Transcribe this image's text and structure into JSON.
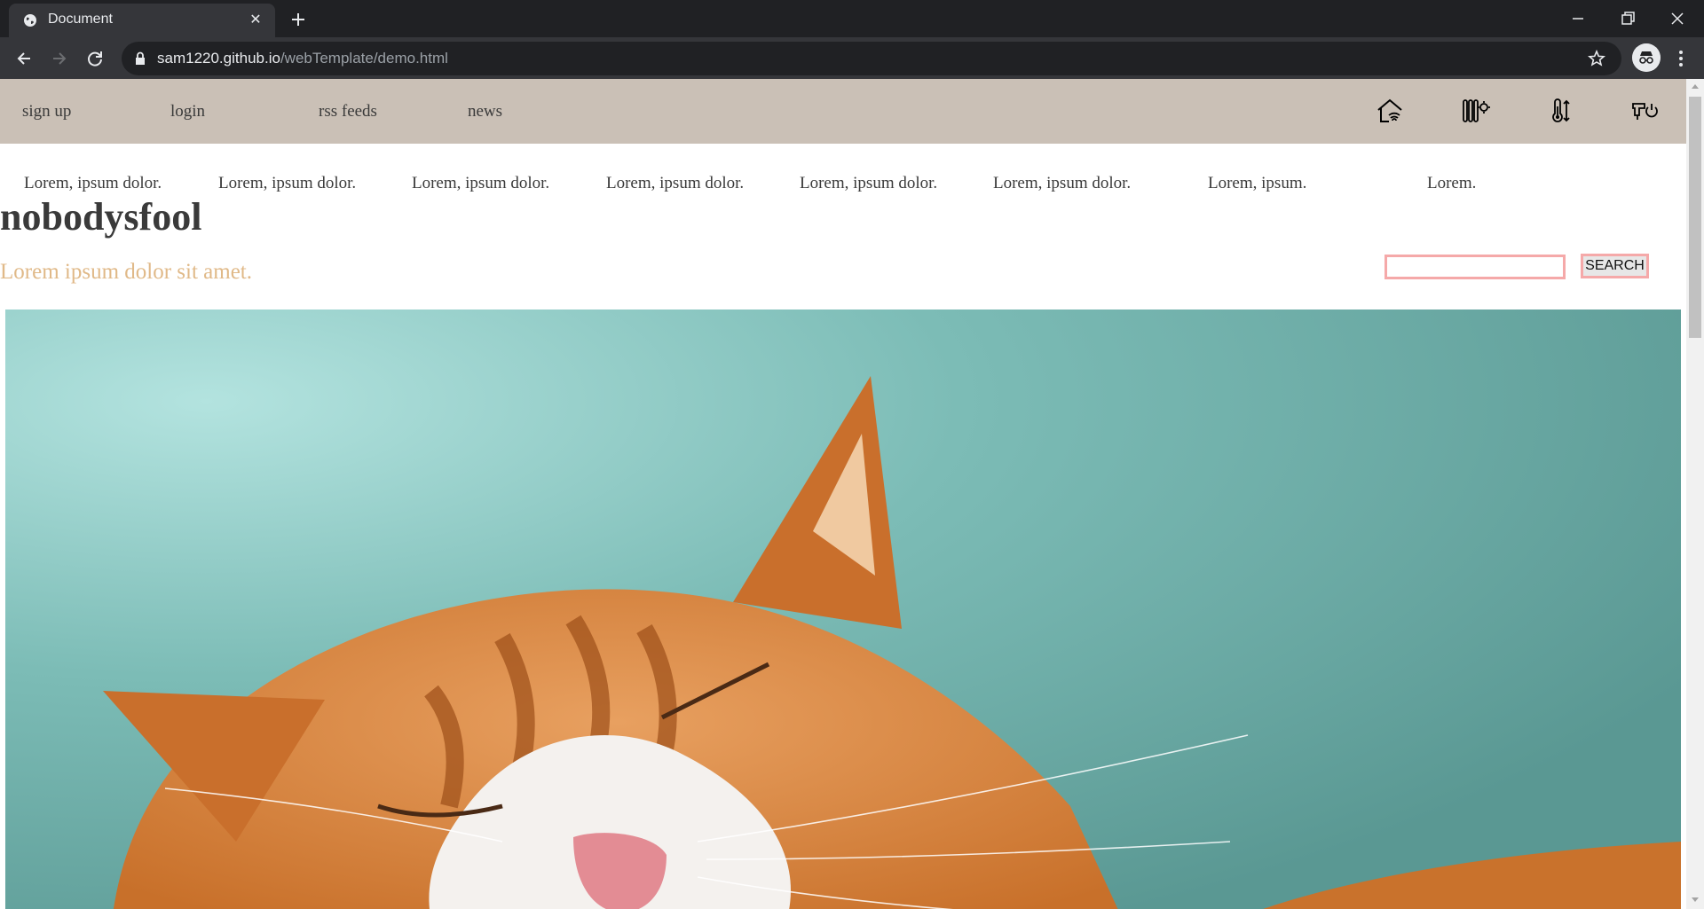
{
  "browser": {
    "tab_title": "Document",
    "tab_close": "✕",
    "url_host": "sam1220.github.io",
    "url_path": "/webTemplate/demo.html"
  },
  "topbar": {
    "links": [
      "sign up",
      "login",
      "rss feeds",
      "news"
    ],
    "icons": [
      "home-wifi-icon",
      "radiator-settings-icon",
      "thermometer-icon",
      "faucet-power-icon"
    ]
  },
  "subnav": {
    "items": [
      "Lorem, ipsum dolor.",
      "Lorem, ipsum dolor.",
      "Lorem, ipsum dolor.",
      "Lorem, ipsum dolor.",
      "Lorem, ipsum dolor.",
      "Lorem, ipsum dolor.",
      "Lorem, ipsum.",
      "Lorem."
    ]
  },
  "header": {
    "title": "nobodysfool",
    "tagline": "Lorem ipsum dolor sit amet."
  },
  "search": {
    "placeholder": "",
    "button_label": "SEARCH"
  },
  "hero": {
    "image": "sleeping-cat-photo"
  },
  "colors": {
    "topbar_bg": "#cac0b6",
    "tagline": "#e0b988",
    "search_border": "#f5a9a9",
    "hero_bg": "#5fa39e",
    "cat_fur": "#d9843a"
  }
}
